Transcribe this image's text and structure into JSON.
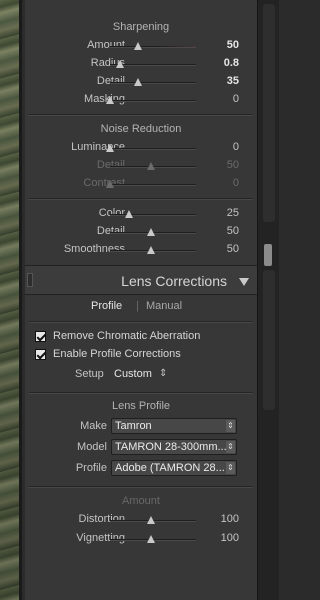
{
  "detail": {
    "sharpening_title": "Sharpening",
    "sharpening": [
      {
        "label": "Amount",
        "value": "50",
        "level": 0.32
      },
      {
        "label": "Radius",
        "value": "0.8",
        "level": 0.12
      },
      {
        "label": "Detail",
        "value": "35",
        "level": 0.33
      },
      {
        "label": "Masking",
        "value": "0",
        "level": 0.0
      }
    ],
    "noise_title": "Noise Reduction",
    "noise_luminance": [
      {
        "label": "Luminance",
        "value": "0",
        "level": 0.0
      },
      {
        "label": "Detail",
        "value": "50",
        "level": 0.48
      },
      {
        "label": "Contrast",
        "value": "0",
        "level": 0.0
      }
    ],
    "noise_color": [
      {
        "label": "Color",
        "value": "25",
        "level": 0.22
      },
      {
        "label": "Detail",
        "value": "50",
        "level": 0.48
      },
      {
        "label": "Smoothness",
        "value": "50",
        "level": 0.48
      }
    ]
  },
  "lens_corrections": {
    "title": "Lens Corrections",
    "tabs": {
      "profile": "Profile",
      "separator": "|",
      "manual": "Manual"
    },
    "remove_ca": {
      "label": "Remove Chromatic Aberration",
      "checked": true
    },
    "enable_profile": {
      "label": "Enable Profile Corrections",
      "checked": true
    },
    "setup": {
      "label": "Setup",
      "value": "Custom",
      "arrow": "⇕"
    },
    "lens_profile_title": "Lens Profile",
    "make": {
      "label": "Make",
      "value": "Tamron"
    },
    "model": {
      "label": "Model",
      "value": "TAMRON 28-300mm..."
    },
    "profile": {
      "label": "Profile",
      "value": "Adobe (TAMRON 28..."
    },
    "amount_title": "Amount",
    "amount": [
      {
        "label": "Distortion",
        "value": "100",
        "level": 0.48
      },
      {
        "label": "Vignetting",
        "value": "100",
        "level": 0.48
      }
    ]
  },
  "icons": {
    "collapse": "triangle-down-icon",
    "spinner": "up-down-arrows-icon",
    "checkbox": "check-icon"
  }
}
